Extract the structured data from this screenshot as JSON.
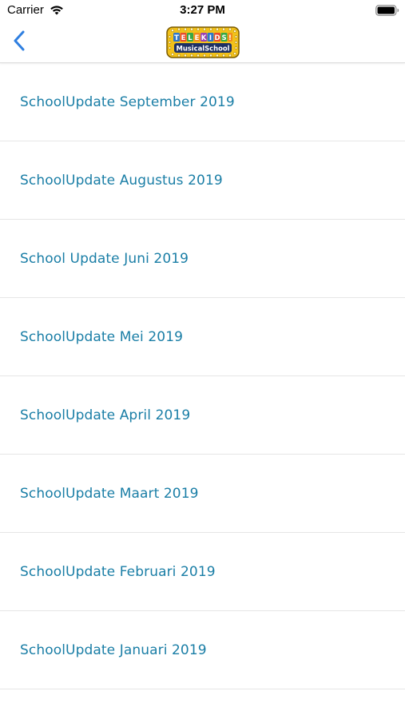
{
  "status_bar": {
    "carrier": "Carrier",
    "time": "3:27 PM",
    "wifi_icon": "wifi-icon",
    "battery_icon": "battery-icon"
  },
  "nav_bar": {
    "back_icon": "chevron-left-icon",
    "logo": {
      "line1": "TELEKIDS!",
      "line2": "MusicalSchool"
    }
  },
  "colors": {
    "accent": "#1a7ea6",
    "back_chevron": "#2f7fe0",
    "separator": "#e6e6e6",
    "logo_gold": "#f2c11a"
  },
  "list": {
    "items": [
      {
        "label": "SchoolUpdate September 2019"
      },
      {
        "label": "SchoolUpdate Augustus 2019"
      },
      {
        "label": "School Update Juni 2019"
      },
      {
        "label": "SchoolUpdate Mei 2019"
      },
      {
        "label": "SchoolUpdate April 2019"
      },
      {
        "label": "SchoolUpdate Maart 2019"
      },
      {
        "label": "SchoolUpdate Februari 2019"
      },
      {
        "label": "SchoolUpdate Januari 2019"
      }
    ]
  }
}
